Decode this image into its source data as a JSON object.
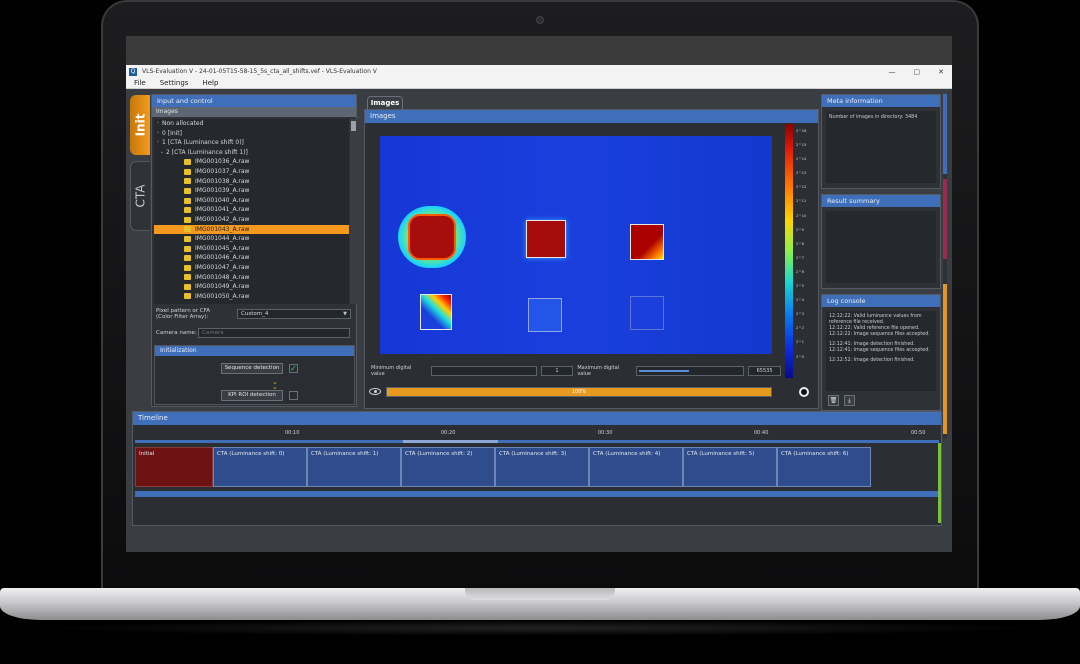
{
  "window": {
    "title": "VLS-Evaluation V  -  24-01-05T15-58-15_5s_cta_all_shifts.vef - VLS-Evaluation V",
    "app_icon": "Q",
    "controls": [
      "—",
      "▢",
      "✕"
    ]
  },
  "menu": [
    "File",
    "Settings",
    "Help"
  ],
  "side_tabs": {
    "init": "Init",
    "cta": "CTA"
  },
  "left_panel": {
    "title": "Input and control",
    "images_label": "Images",
    "tree": [
      {
        "chev": "›",
        "label": "Non allocated",
        "file": false,
        "selected": false
      },
      {
        "chev": "›",
        "label": "0 [Init]",
        "file": false,
        "selected": false
      },
      {
        "chev": "›",
        "label": "1 [CTA (Luminance shift 0)]",
        "file": false,
        "selected": false
      },
      {
        "chev": "⌄",
        "label": "2 [CTA (Luminance shift 1)]",
        "file": false,
        "selected": false
      },
      {
        "chev": "",
        "label": "IMG001036_A.raw",
        "file": true,
        "selected": false
      },
      {
        "chev": "",
        "label": "IMG001037_A.raw",
        "file": true,
        "selected": false
      },
      {
        "chev": "",
        "label": "IMG001038_A.raw",
        "file": true,
        "selected": false
      },
      {
        "chev": "",
        "label": "IMG001039_A.raw",
        "file": true,
        "selected": false
      },
      {
        "chev": "",
        "label": "IMG001040_A.raw",
        "file": true,
        "selected": false
      },
      {
        "chev": "",
        "label": "IMG001041_A.raw",
        "file": true,
        "selected": false
      },
      {
        "chev": "",
        "label": "IMG001042_A.raw",
        "file": true,
        "selected": false
      },
      {
        "chev": "",
        "label": "IMG001043_A.raw",
        "file": true,
        "selected": true
      },
      {
        "chev": "",
        "label": "IMG001044_A.raw",
        "file": true,
        "selected": false
      },
      {
        "chev": "",
        "label": "IMG001045_A.raw",
        "file": true,
        "selected": false
      },
      {
        "chev": "",
        "label": "IMG001046_A.raw",
        "file": true,
        "selected": false
      },
      {
        "chev": "",
        "label": "IMG001047_A.raw",
        "file": true,
        "selected": false
      },
      {
        "chev": "",
        "label": "IMG001048_A.raw",
        "file": true,
        "selected": false
      },
      {
        "chev": "",
        "label": "IMG001049_A.raw",
        "file": true,
        "selected": false
      },
      {
        "chev": "",
        "label": "IMG001050_A.raw",
        "file": true,
        "selected": false
      }
    ],
    "pixel_pattern_label_1": "Pixel pattern or CFA",
    "pixel_pattern_label_2": "(Color Filter Array):",
    "pixel_pattern_value": "Custom_4",
    "camera_name_label": "Camera name:",
    "camera_name_placeholder": "Camera",
    "init_section": {
      "title": "Initialization",
      "sequence_button": "Sequence detection",
      "sequence_checked": "✓",
      "kpi_button": "KPI ROI detection",
      "kpi_checked": ""
    }
  },
  "center_panel": {
    "tab": "Images",
    "header": "Images",
    "min_label": "Minimum digital value",
    "min_value": "1",
    "max_label": "Maximum digital value",
    "max_value": "65535",
    "progress_percent": 100,
    "progress_text": "100%",
    "colorbar_ticks": [
      "2^16",
      "2^15",
      "2^14",
      "2^13",
      "2^12",
      "2^11",
      "2^10",
      "2^9",
      "2^8",
      "2^7",
      "2^6",
      "2^5",
      "2^4",
      "2^3",
      "2^2",
      "2^1",
      "2^0",
      "",
      ""
    ]
  },
  "meta_panel": {
    "title": "Meta information",
    "text": "Number of images in directory: 3484"
  },
  "result_panel": {
    "title": "Result summary"
  },
  "log_panel": {
    "title": "Log console",
    "lines": [
      "12:12:22: Valid luminance values from",
      "reference file received.",
      "12:12:22: Valid reference file opened.",
      "12:12:22: Image sequence files accepted.",
      "",
      "12:12:41: Image detection finished.",
      "12:12:41: Image sequence files accepted.",
      "",
      "12:12:52: Image detection finished."
    ],
    "clear_icon": "🗑",
    "download_icon": "⤓"
  },
  "timeline": {
    "title": "Timeline",
    "ticks": [
      "00:10",
      "00:20",
      "00:30",
      "00:40",
      "00:50"
    ],
    "segments": [
      "Initial",
      "CTA (Luminance shift: 0)",
      "CTA (Luminance shift: 1)",
      "CTA (Luminance shift: 2)",
      "CTA (Luminance shift: 3)",
      "CTA (Luminance shift: 4)",
      "CTA (Luminance shift: 5)",
      "CTA (Luminance shift: 6)"
    ]
  },
  "colors": {
    "accent_orange": "#f39a1e",
    "header_blue": "#3f6fb9",
    "heat_blue": "#1a3fdd",
    "heat_red": "#b01010"
  }
}
